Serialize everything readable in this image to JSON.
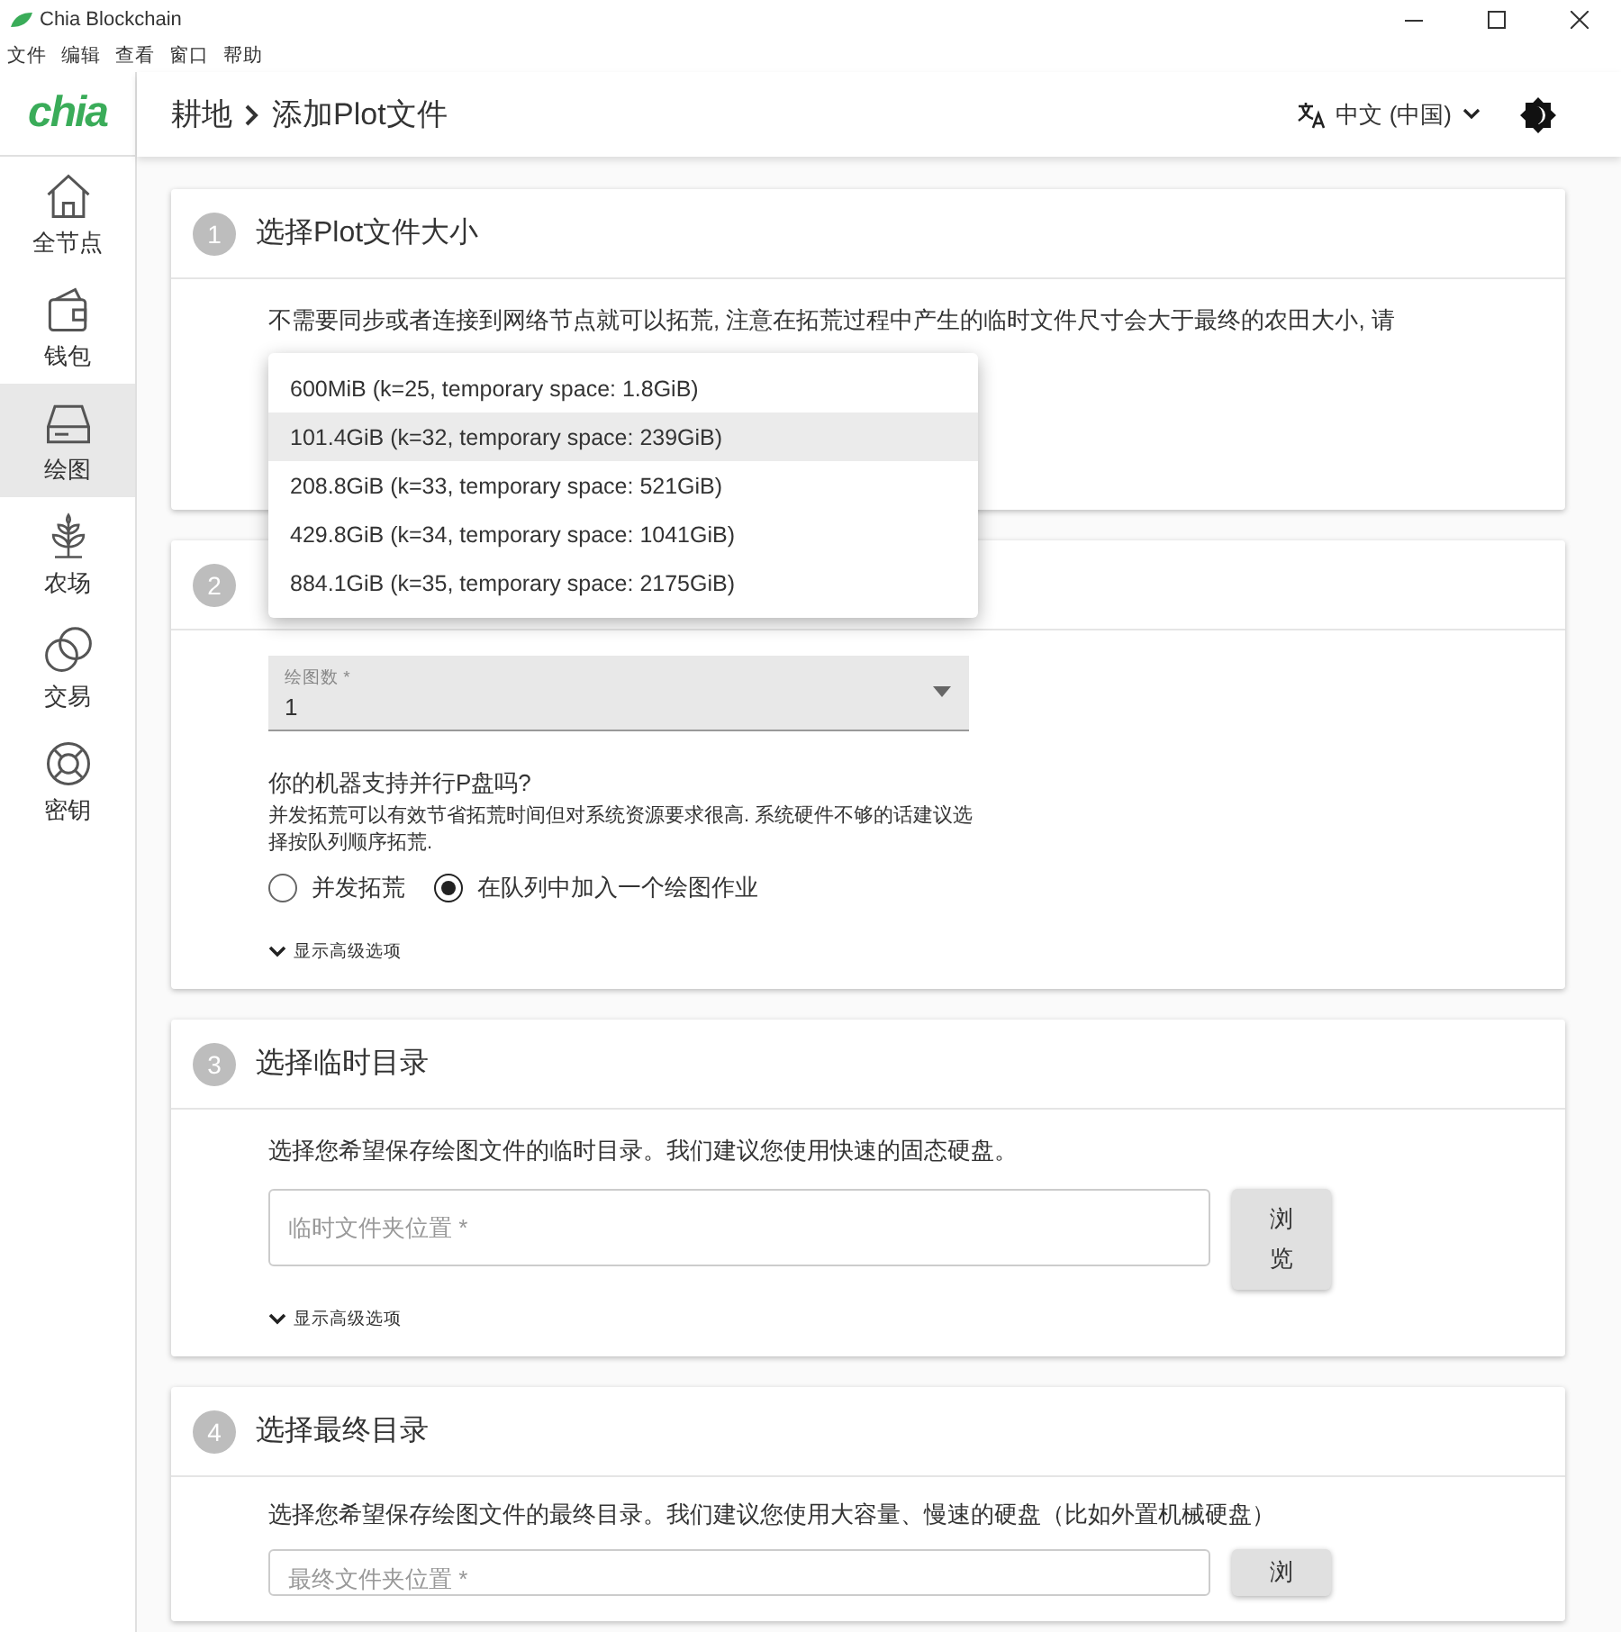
{
  "window": {
    "title": "Chia Blockchain",
    "menu": [
      "文件",
      "编辑",
      "查看",
      "窗口",
      "帮助"
    ]
  },
  "sidebar": {
    "logo": "chia",
    "items": [
      {
        "label": "全节点",
        "selected": false
      },
      {
        "label": "钱包",
        "selected": false
      },
      {
        "label": "绘图",
        "selected": true
      },
      {
        "label": "农场",
        "selected": false
      },
      {
        "label": "交易",
        "selected": false
      },
      {
        "label": "密钥",
        "selected": false
      }
    ]
  },
  "header": {
    "breadcrumb": [
      "耕地",
      "添加Plot文件"
    ],
    "language": "中文 (中国)"
  },
  "steps": [
    {
      "number": "1",
      "title": "选择Plot文件大小",
      "description": "不需要同步或者连接到网络节点就可以拓荒, 注意在拓荒过程中产生的临时文件尺寸会大于最终的农田大小, 请"
    },
    {
      "number": "2",
      "count_field": {
        "label": "绘图数 *",
        "value": "1"
      },
      "question": "你的机器支持并行P盘吗?",
      "hint": "并发拓荒可以有效节省拓荒时间但对系统资源要求很高. 系统硬件不够的话建议选择按队列顺序拓荒.",
      "options": [
        {
          "label": "并发拓荒",
          "selected": false
        },
        {
          "label": "在队列中加入一个绘图作业",
          "selected": true
        }
      ],
      "advanced": "显示高级选项"
    },
    {
      "number": "3",
      "title": "选择临时目录",
      "description": "选择您希望保存绘图文件的临时目录。我们建议您使用快速的固态硬盘。",
      "field": {
        "placeholder": "临时文件夹位置 *"
      },
      "button": "浏览",
      "advanced": "显示高级选项"
    },
    {
      "number": "4",
      "title": "选择最终目录",
      "description": "选择您希望保存绘图文件的最终目录。我们建议您使用大容量、慢速的硬盘（比如外置机械硬盘）",
      "field": {
        "placeholder": "最终文件夹位置 *"
      },
      "button": "浏"
    }
  ],
  "size_menu": {
    "items": [
      {
        "label": "600MiB (k=25, temporary space: 1.8GiB)",
        "selected": false
      },
      {
        "label": "101.4GiB (k=32, temporary space: 239GiB)",
        "selected": true
      },
      {
        "label": "208.8GiB (k=33, temporary space: 521GiB)",
        "selected": false
      },
      {
        "label": "429.8GiB (k=34, temporary space: 1041GiB)",
        "selected": false
      },
      {
        "label": "884.1GiB (k=35, temporary space: 2175GiB)",
        "selected": false
      }
    ]
  }
}
